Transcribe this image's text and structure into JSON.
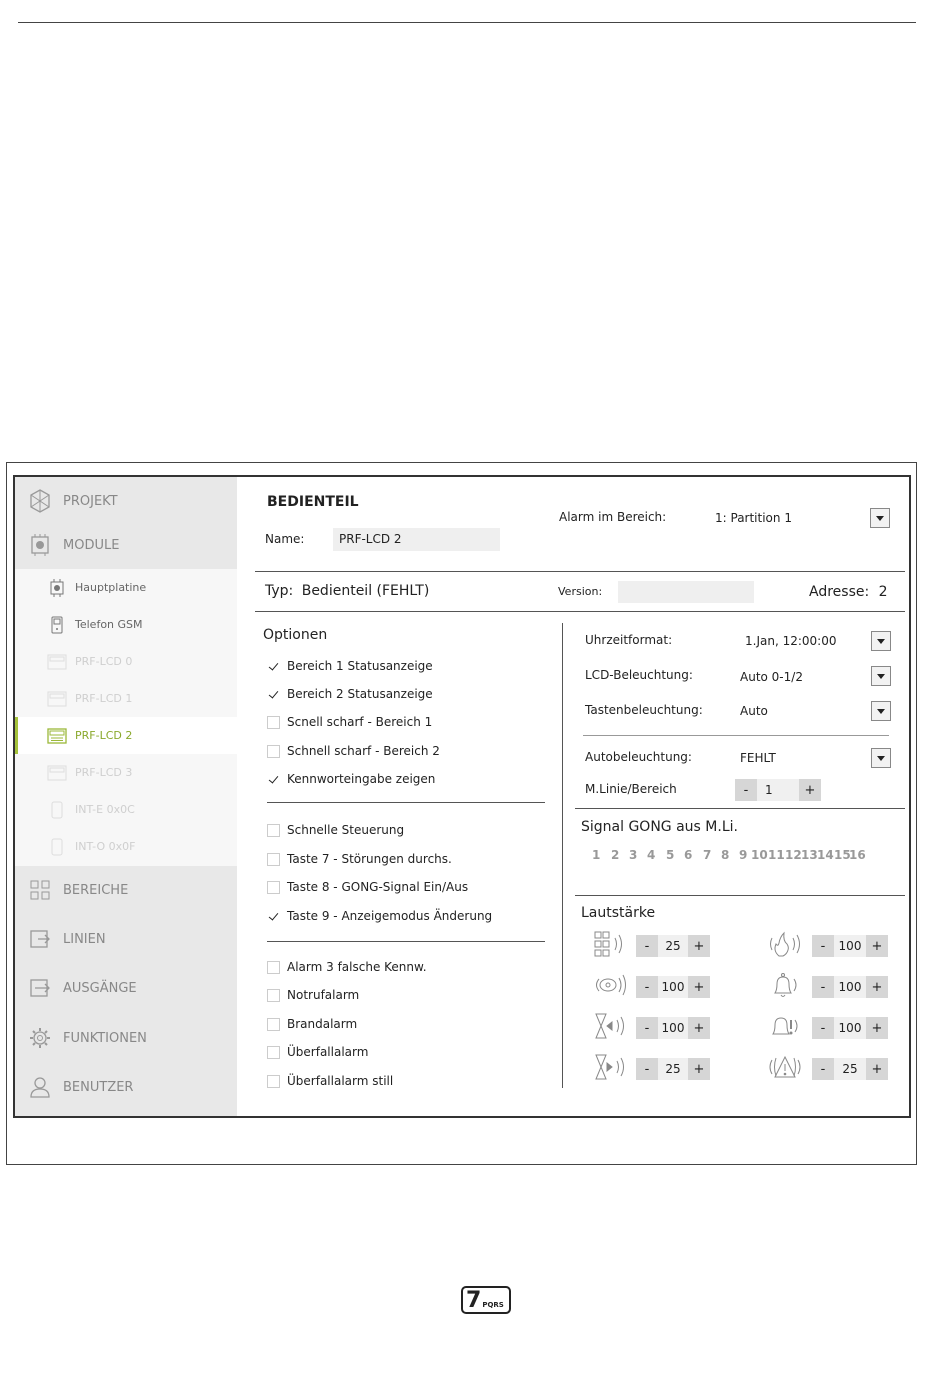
{
  "sidebar": {
    "main_top": [
      {
        "label": "PROJEKT",
        "icon": "project-icon"
      },
      {
        "label": "MODULE",
        "icon": "module-icon"
      }
    ],
    "modules": [
      {
        "label": "Hauptplatine",
        "icon": "mainboard-icon",
        "state": "normal"
      },
      {
        "label": "Telefon GSM",
        "icon": "phone-icon",
        "state": "normal"
      },
      {
        "label": "PRF-LCD 0",
        "icon": "keypad-icon",
        "state": "dim"
      },
      {
        "label": "PRF-LCD 1",
        "icon": "keypad-icon",
        "state": "dim"
      },
      {
        "label": "PRF-LCD 2",
        "icon": "keypad-icon",
        "state": "active"
      },
      {
        "label": "PRF-LCD 3",
        "icon": "keypad-icon",
        "state": "dim"
      },
      {
        "label": "INT-E 0x0C",
        "icon": "expander-icon",
        "state": "dim"
      },
      {
        "label": "INT-O 0x0F",
        "icon": "expander-icon",
        "state": "dim"
      }
    ],
    "main_bottom": [
      {
        "label": "BEREICHE",
        "icon": "partitions-icon"
      },
      {
        "label": "LINIEN",
        "icon": "zones-icon"
      },
      {
        "label": "AUSGÄNGE",
        "icon": "outputs-icon"
      },
      {
        "label": "FUNKTIONEN",
        "icon": "gear-icon"
      },
      {
        "label": "BENUTZER",
        "icon": "user-icon"
      }
    ]
  },
  "header": {
    "title": "BEDIENTEIL",
    "name_label": "Name:",
    "name_value": "PRF-LCD 2",
    "alarm_label": "Alarm im Bereich:",
    "alarm_value": "1: Partition 1"
  },
  "typebar": {
    "type_label": "Typ:",
    "type_value": "Bedienteil (FEHLT)",
    "version_label": "Version:",
    "version_value": "",
    "address_label": "Adresse:",
    "address_value": "2"
  },
  "options": {
    "title": "Optionen",
    "group1": [
      {
        "label": "Bereich 1 Statusanzeige",
        "checked": true
      },
      {
        "label": "Bereich 2 Statusanzeige",
        "checked": true
      },
      {
        "label": "Scnell scharf - Bereich 1",
        "checked": false
      },
      {
        "label": "Schnell scharf - Bereich 2",
        "checked": false
      },
      {
        "label": "Kennworteingabe zeigen",
        "checked": true
      }
    ],
    "group2": [
      {
        "label": "Schnelle Steuerung",
        "checked": false
      },
      {
        "label": "Taste 7 - Störungen durchs.",
        "checked": false
      },
      {
        "label": "Taste 8 - GONG-Signal Ein/Aus",
        "checked": false
      },
      {
        "label": "Taste 9 - Anzeigemodus Änderung",
        "checked": true
      }
    ],
    "group3": [
      {
        "label": "Alarm 3 falsche Kennw.",
        "checked": false
      },
      {
        "label": "Notrufalarm",
        "checked": false
      },
      {
        "label": "Brandalarm",
        "checked": false
      },
      {
        "label": "Überfallalarm",
        "checked": false
      },
      {
        "label": "Überfallalarm still",
        "checked": false
      }
    ]
  },
  "settings": {
    "time_label": "Uhrzeitformat:",
    "time_value": "1.Jan, 12:00:00",
    "lcd_label": "LCD-Beleuchtung:",
    "lcd_value": "Auto 0-1/2",
    "keys_label": "Tastenbeleuchtung:",
    "keys_value": "Auto",
    "auto_label": "Autobeleuchtung:",
    "auto_value": "FEHLT",
    "zone_label": "M.Linie/Bereich",
    "zone_value": "1",
    "minus": "-",
    "plus": "+"
  },
  "gong": {
    "title": "Signal GONG aus M.Li.",
    "numbers": [
      "1",
      "2",
      "3",
      "4",
      "5",
      "6",
      "7",
      "8",
      "9",
      "10",
      "11",
      "12",
      "13",
      "14",
      "15",
      "16"
    ]
  },
  "volume": {
    "title": "Lautstärke",
    "left": [
      {
        "icon": "keypad-sound-icon",
        "value": "25"
      },
      {
        "icon": "chime-sound-icon",
        "value": "100"
      },
      {
        "icon": "entry-delay-sound-icon",
        "value": "100"
      },
      {
        "icon": "exit-delay-sound-icon",
        "value": "25"
      }
    ],
    "right": [
      {
        "icon": "fire-alarm-sound-icon",
        "value": "100"
      },
      {
        "icon": "bell-alarm-sound-icon",
        "value": "100"
      },
      {
        "icon": "bell-warning-sound-icon",
        "value": "100"
      },
      {
        "icon": "warning-sound-icon",
        "value": "25"
      }
    ]
  },
  "footer_logo": {
    "digit": "7",
    "letters": "PQRS"
  }
}
